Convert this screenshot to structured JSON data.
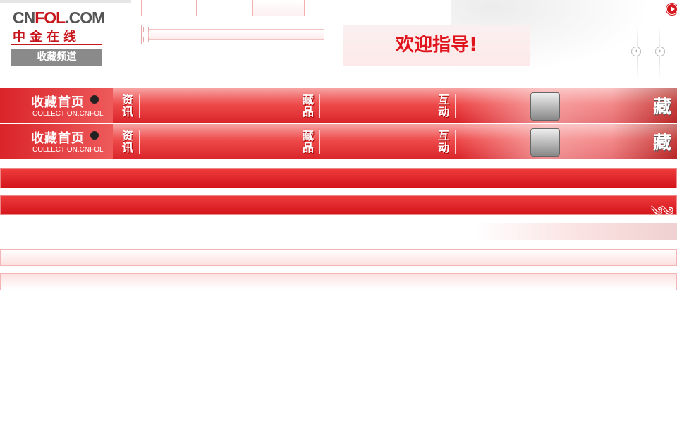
{
  "logo": {
    "brand_prefix": "CN",
    "brand_mid": "FOL",
    "brand_suffix": ".COM",
    "cn_name": "中金在线",
    "channel_label": "收藏频道"
  },
  "welcome_text": "欢迎指导!",
  "nav": {
    "home_label": "收藏首页",
    "home_sub": "COLLECTION.CNFOL",
    "items": [
      {
        "label": "资讯",
        "top": "资",
        "bottom": "讯"
      },
      {
        "label": "藏品",
        "top": "藏",
        "bottom": "品"
      },
      {
        "label": "互动",
        "top": "互",
        "bottom": "动"
      }
    ],
    "big_char": "藏"
  },
  "colors": {
    "brand_red": "#c8161d",
    "bar_red": "#d9242a",
    "pink_border": "#f2b4b4"
  },
  "icons": [
    "play-icon",
    "prev-arrow-icon",
    "next-arrow-icon",
    "cloud-ornament-icon",
    "brush-icon"
  ]
}
